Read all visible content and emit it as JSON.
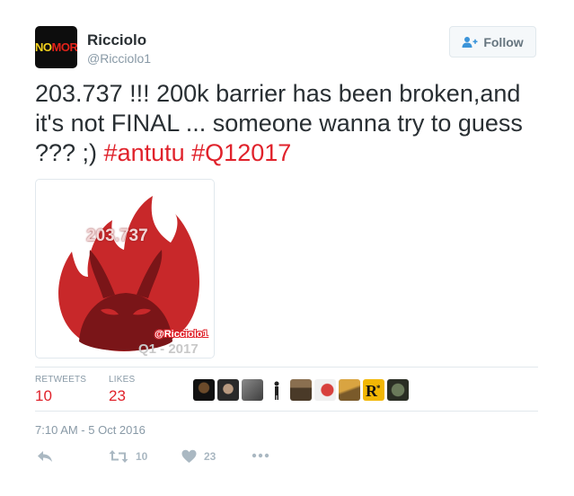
{
  "user": {
    "avatar_text_line1": "NO",
    "avatar_text_line2": "MORE",
    "display_name": "Ricciolo",
    "screen_name": "@Ricciolo1"
  },
  "follow_button": {
    "label": "Follow",
    "icon": "add-user-icon"
  },
  "tweet": {
    "text_main": "203.737 !!! 200k barrier has been broken,and it's not FINAL ... someone wanna try to guess ??? ;) ",
    "hashtags": [
      "#antutu",
      "#Q12017"
    ]
  },
  "media": {
    "score": "203.737",
    "watermark": "@Ricciolo1",
    "caption": "Q1 - 2017"
  },
  "stats": {
    "retweets_label": "RETWEETS",
    "retweets_value": "10",
    "likes_label": "LIKES",
    "likes_value": "23",
    "liker_avatars": [
      "avatar-1",
      "avatar-2",
      "avatar-3",
      "avatar-4",
      "avatar-5",
      "avatar-6",
      "avatar-7",
      "avatar-8",
      "avatar-9"
    ]
  },
  "timestamp": "7:10 AM - 5 Oct 2016",
  "actions": {
    "reply_icon": "reply-icon",
    "retweet_icon": "retweet-icon",
    "retweet_count": "10",
    "like_icon": "heart-icon",
    "like_count": "23",
    "more_icon": "more-icon"
  },
  "colors": {
    "hashtag": "#e0222b",
    "stat_value": "#e0222b",
    "secondary_text": "#8899a6",
    "antutu_red": "#c8282a",
    "antutu_dark": "#7a1518"
  }
}
